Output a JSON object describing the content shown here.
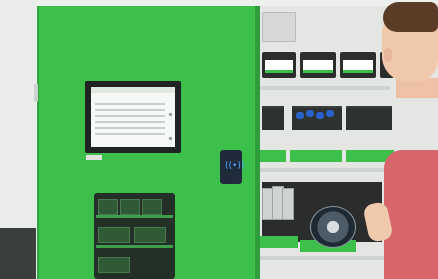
{
  "scene": {
    "description_type": "photo",
    "colors": {
      "cabinet_green": "#3cc04b",
      "cabinet_dark": "#2b2e2d",
      "screen_bg": "#f6f8f6",
      "reader_blue": "#1f2b3a",
      "shirt": "#d7656a",
      "skin": "#f0c9ad"
    },
    "icons": {
      "rfid_reader": "contactless-icon"
    }
  }
}
